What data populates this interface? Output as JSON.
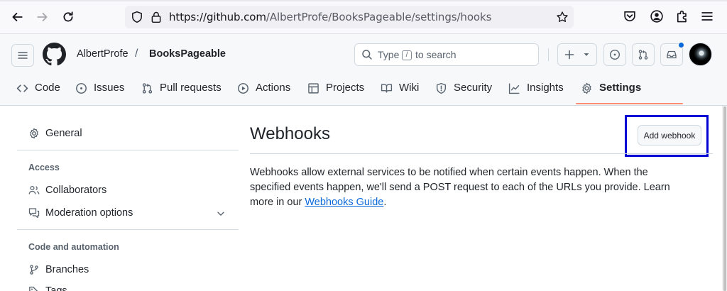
{
  "browser": {
    "url_host": "https://github.com",
    "url_path": "/AlbertProfe/BooksPageable/settings/hooks"
  },
  "header": {
    "owner": "AlbertProfe",
    "separator": "/",
    "repo": "BooksPageable",
    "search_placeholder_before": "Type",
    "search_key": "/",
    "search_placeholder_after": "to search",
    "create_label": "+"
  },
  "tabs": [
    {
      "label": "Code",
      "icon": "code-icon"
    },
    {
      "label": "Issues",
      "icon": "issue-icon"
    },
    {
      "label": "Pull requests",
      "icon": "pull-request-icon"
    },
    {
      "label": "Actions",
      "icon": "play-icon"
    },
    {
      "label": "Projects",
      "icon": "table-icon"
    },
    {
      "label": "Wiki",
      "icon": "book-icon"
    },
    {
      "label": "Security",
      "icon": "shield-icon"
    },
    {
      "label": "Insights",
      "icon": "graph-icon"
    },
    {
      "label": "Settings",
      "icon": "gear-icon",
      "active": true
    }
  ],
  "sidebar": {
    "general": "General",
    "access_heading": "Access",
    "collaborators": "Collaborators",
    "moderation": "Moderation options",
    "code_heading": "Code and automation",
    "branches": "Branches",
    "tags": "Tags"
  },
  "main": {
    "title": "Webhooks",
    "add_button": "Add webhook",
    "description": "Webhooks allow external services to be notified when certain events happen. When the specified events happen, we'll send a POST request to each of the URLs you provide. Learn more in our ",
    "link_text": "Webhooks Guide",
    "period": "."
  },
  "colors": {
    "accent_link": "#0969da",
    "tab_underline": "#fd8c73",
    "highlight_box": "#0000d4"
  }
}
